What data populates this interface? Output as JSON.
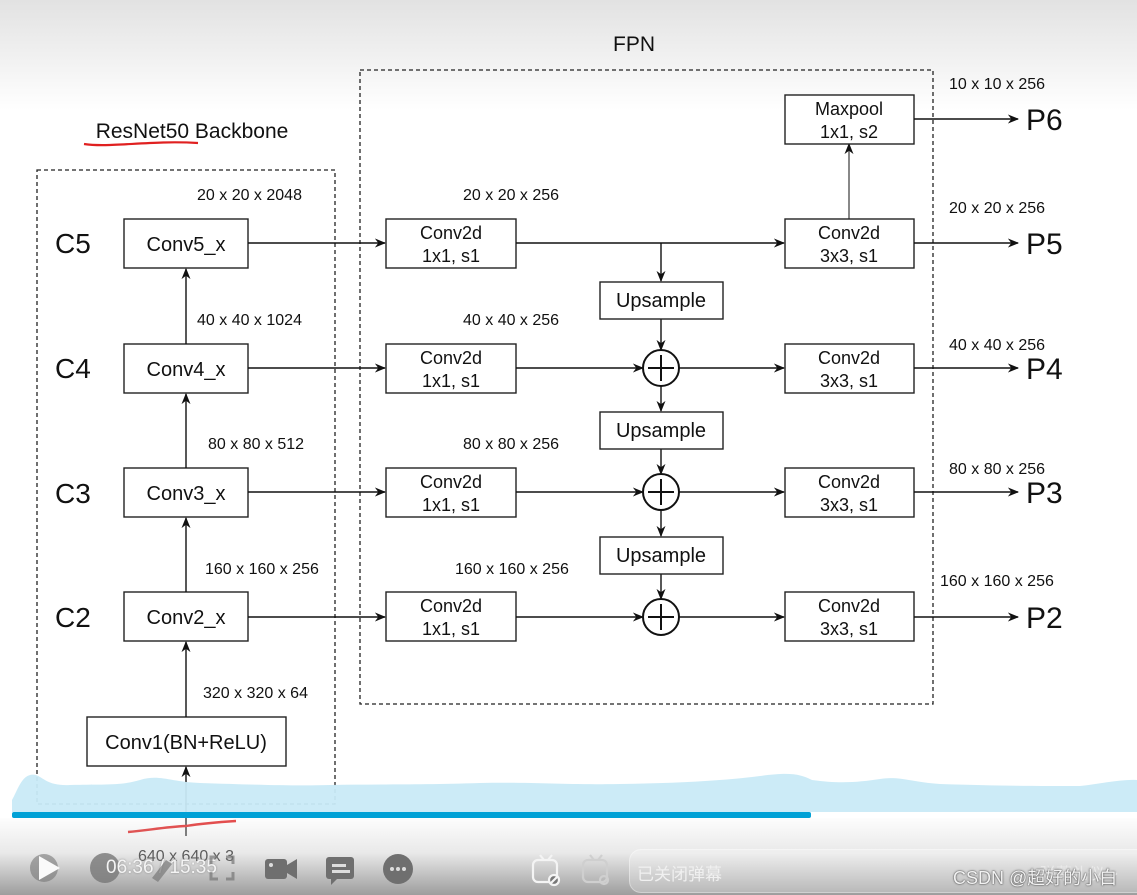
{
  "diagram": {
    "fpn_title": "FPN",
    "backbone_title": "ResNet50 Backbone",
    "input_shape": "640 x 640 x 3",
    "backbone": {
      "stem": {
        "label": "Conv1(BN+ReLU)",
        "output_shape": "320 x 320 x 64"
      },
      "stages": [
        {
          "level": "C2",
          "label": "Conv2_x",
          "output_shape": "160 x 160 x 256"
        },
        {
          "level": "C3",
          "label": "Conv3_x",
          "output_shape": "80 x 80 x 512"
        },
        {
          "level": "C4",
          "label": "Conv4_x",
          "output_shape": "40 x 40 x 1024"
        },
        {
          "level": "C5",
          "label": "Conv5_x",
          "output_shape": "20 x 20 x 2048"
        }
      ]
    },
    "lateral": [
      {
        "line1": "Conv2d",
        "line2": "1x1, s1",
        "shape": "160 x 160 x 256"
      },
      {
        "line1": "Conv2d",
        "line2": "1x1, s1",
        "shape": "80 x 80 x 256"
      },
      {
        "line1": "Conv2d",
        "line2": "1x1, s1",
        "shape": "40 x 40 x 256"
      },
      {
        "line1": "Conv2d",
        "line2": "1x1, s1",
        "shape": "20 x 20 x 256"
      }
    ],
    "upsample_label": "Upsample",
    "add_symbol": "+",
    "output_convs": [
      {
        "line1": "Conv2d",
        "line2": "3x3, s1"
      },
      {
        "line1": "Conv2d",
        "line2": "3x3, s1"
      },
      {
        "line1": "Conv2d",
        "line2": "3x3, s1"
      },
      {
        "line1": "Conv2d",
        "line2": "3x3, s1"
      }
    ],
    "maxpool": {
      "line1": "Maxpool",
      "line2": "1x1, s2"
    },
    "outputs": [
      {
        "name": "P2",
        "shape": "160 x 160 x 256"
      },
      {
        "name": "P3",
        "shape": "80 x 80 x 256"
      },
      {
        "name": "P4",
        "shape": "40 x 40 x 256"
      },
      {
        "name": "P5",
        "shape": "20 x 20 x 256"
      },
      {
        "name": "P6",
        "shape": "10 x 10 x 256"
      }
    ]
  },
  "annotation_color": "#e02020",
  "player": {
    "current_time": "06:36",
    "separator": "/",
    "duration": "15:35",
    "progress_percent": 71,
    "progress_color": "#00a1d6",
    "icons": [
      "play-icon",
      "next-icon",
      "pen-icon",
      "fullscreen-icon",
      "camera-icon",
      "comment-icon",
      "more-icon",
      "danmaku-off-icon",
      "danmaku-settings-icon"
    ],
    "danmaku_placeholder": "已关闭弹幕",
    "danmaku_etiquette": "弹幕礼仪 >"
  },
  "watermark": "CSDN @超好的小白"
}
